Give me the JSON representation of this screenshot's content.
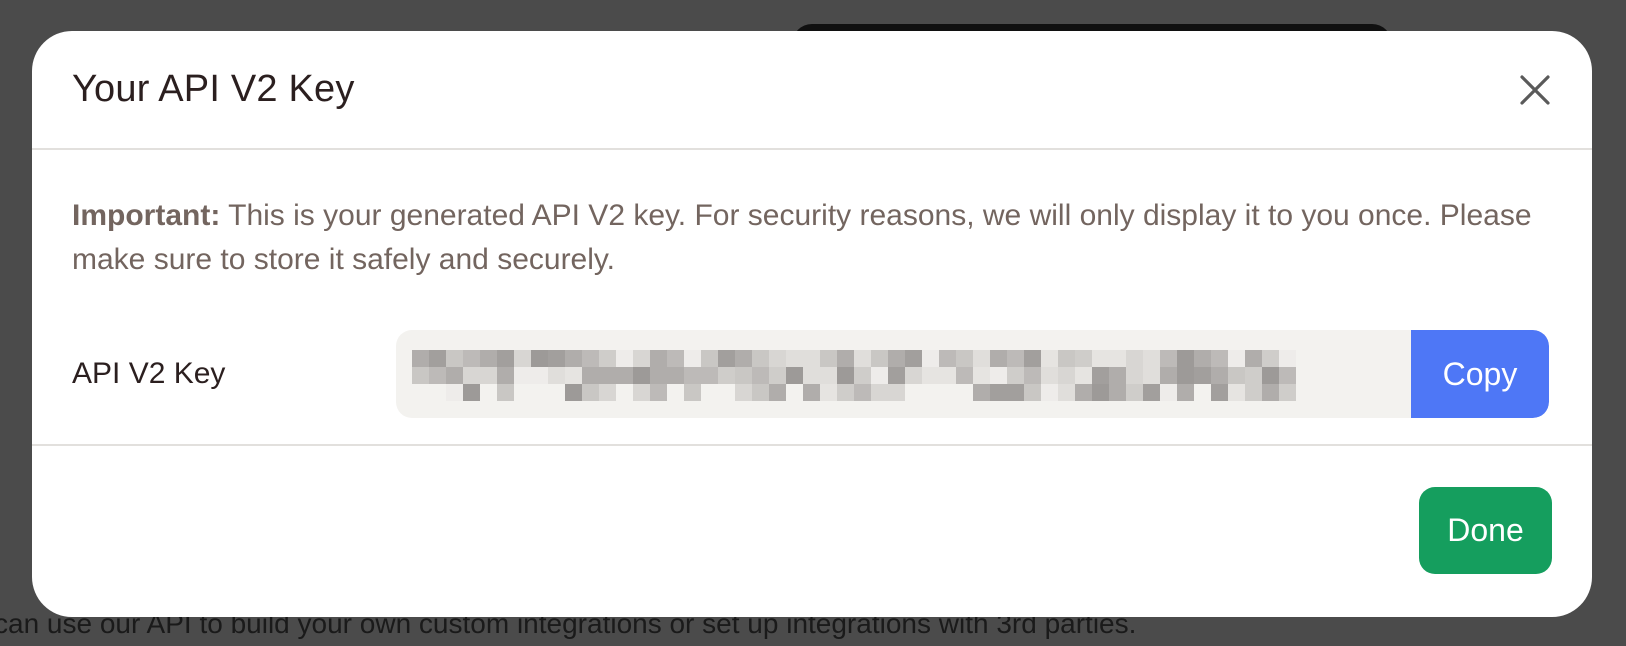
{
  "background": {
    "text": "can use our API to build your own custom integrations or set up integrations with 3rd parties."
  },
  "modal": {
    "title": "Your API V2 Key",
    "close_icon": "close-icon",
    "notice_bold": "Important:",
    "notice_text": " This is your generated API V2 key. For security reasons, we will only display it to you once. Please make sure to store it safely and securely.",
    "key_label": "API V2 Key",
    "key_value_state": "pixelated-redacted",
    "copy_label": "Copy",
    "done_label": "Done"
  },
  "colors": {
    "overlay": "#4b4b4b",
    "copy_button": "#4e77f6",
    "done_button": "#159e5e",
    "key_field_bg": "#f3f2ef"
  }
}
